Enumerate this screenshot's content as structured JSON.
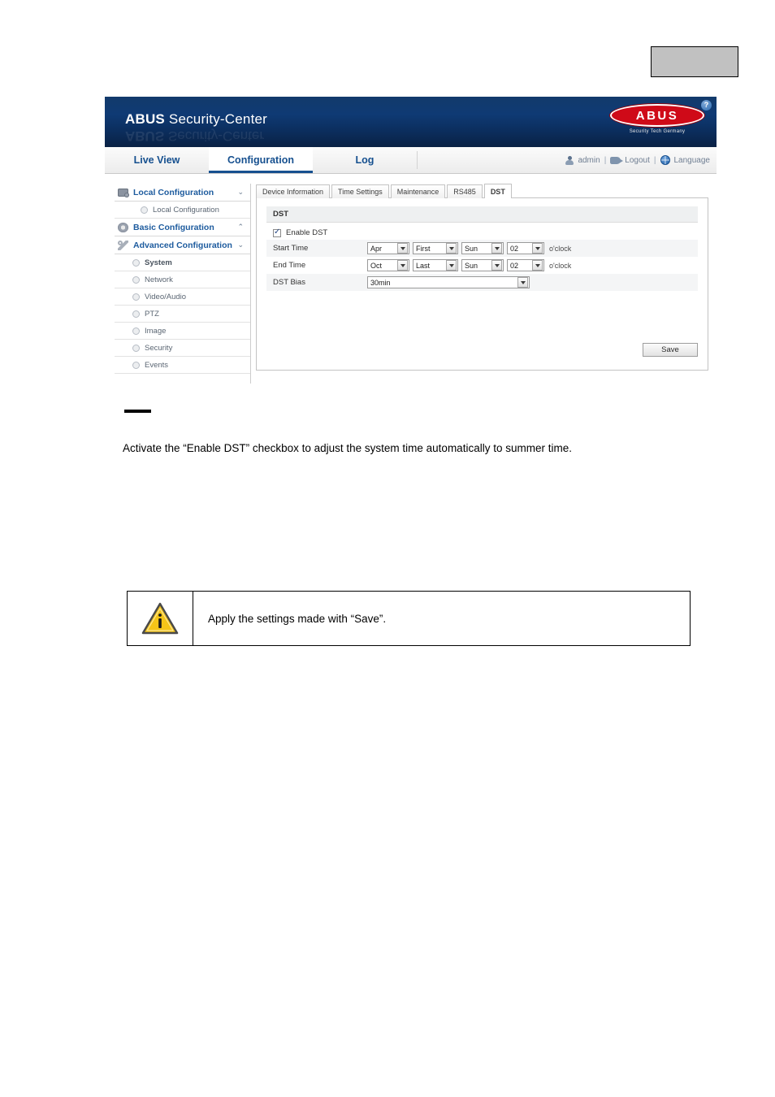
{
  "page": {
    "gray_placeholder_box": true
  },
  "screenshot": {
    "header": {
      "brand_bold": "ABUS",
      "brand_light": " Security-Center",
      "logo_text": "ABUS",
      "logo_subtitle": "Security Tech Germany",
      "help_badge": "?"
    },
    "nav": {
      "tabs": [
        {
          "label": "Live View",
          "active": false
        },
        {
          "label": "Configuration",
          "active": true
        },
        {
          "label": "Log",
          "active": false
        }
      ],
      "user": "admin",
      "logout": "Logout",
      "language": "Language",
      "separator": "|"
    },
    "sidebar": {
      "groups": [
        {
          "label": "Local Configuration",
          "icon": "monitor-icon",
          "chevron": "⌄",
          "items": [
            {
              "label": "Local Configuration",
              "bold": false
            }
          ]
        },
        {
          "label": "Basic Configuration",
          "icon": "gear-icon",
          "chevron": "⌃",
          "items": []
        },
        {
          "label": "Advanced Configuration",
          "icon": "wrench-icon",
          "chevron": "⌄",
          "items": [
            {
              "label": "System",
              "bold": true
            },
            {
              "label": "Network",
              "bold": false
            },
            {
              "label": "Video/Audio",
              "bold": false
            },
            {
              "label": "PTZ",
              "bold": false
            },
            {
              "label": "Image",
              "bold": false
            },
            {
              "label": "Security",
              "bold": false
            },
            {
              "label": "Events",
              "bold": false
            }
          ]
        }
      ]
    },
    "content": {
      "subtabs": [
        {
          "label": "Device Information",
          "active": false
        },
        {
          "label": "Time Settings",
          "active": false
        },
        {
          "label": "Maintenance",
          "active": false
        },
        {
          "label": "RS485",
          "active": false
        },
        {
          "label": "DST",
          "active": true
        }
      ],
      "panel_title": "DST",
      "enable_dst_label": "Enable DST",
      "enable_dst_checked": true,
      "rows": [
        {
          "label": "Start Time",
          "month": "Apr",
          "ordinal": "First",
          "weekday": "Sun",
          "hour": "02",
          "suffix": "o'clock"
        },
        {
          "label": "End Time",
          "month": "Oct",
          "ordinal": "Last",
          "weekday": "Sun",
          "hour": "02",
          "suffix": "o'clock"
        }
      ],
      "dst_bias_label": "DST Bias",
      "dst_bias_value": "30min",
      "save_label": "Save"
    }
  },
  "document": {
    "paragraph": "Activate the “Enable DST” checkbox to adjust the system time automatically to summer time.",
    "note": {
      "icon": "warning-info-triangle-icon",
      "icon_glyph": "i",
      "text": "Apply the settings made with “Save”."
    }
  },
  "colors": {
    "header_blue_top": "#123a6b",
    "header_blue_bottom": "#0a2144",
    "link_blue": "#16508f",
    "logo_red": "#cf0a18",
    "warning_yellow": "#f5c518",
    "placeholder_gray": "#c1c1c1"
  }
}
